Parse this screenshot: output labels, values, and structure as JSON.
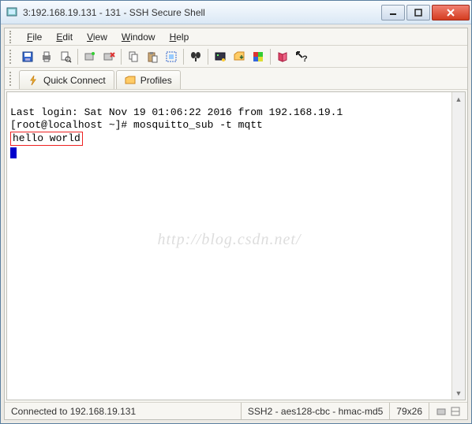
{
  "title": "3:192.168.19.131 - 131 - SSH Secure Shell",
  "menu": {
    "file": "File",
    "edit": "Edit",
    "view": "View",
    "window": "Window",
    "help": "Help"
  },
  "toolbar_icons": [
    "save-icon",
    "print-icon",
    "print-preview-icon",
    "sep",
    "new-connection-icon",
    "disconnect-icon",
    "sep",
    "copy-icon",
    "paste-icon",
    "select-all-icon",
    "sep",
    "find-icon",
    "sep",
    "terminal-icon",
    "file-transfer-icon",
    "color-icon",
    "sep",
    "book-icon",
    "context-help-icon"
  ],
  "tabs": {
    "quick_connect": "Quick Connect",
    "profiles": "Profiles"
  },
  "terminal": {
    "line1": "Last login: Sat Nov 19 01:06:22 2016 from 192.168.19.1",
    "line2": "[root@localhost ~]# mosquitto_sub -t mqtt",
    "line3": "hello world"
  },
  "watermark": "http://blog.csdn.net/",
  "status": {
    "connection": "Connected to 192.168.19.131",
    "protocol": "SSH2 - aes128-cbc - hmac-md5",
    "size": "79x26"
  }
}
